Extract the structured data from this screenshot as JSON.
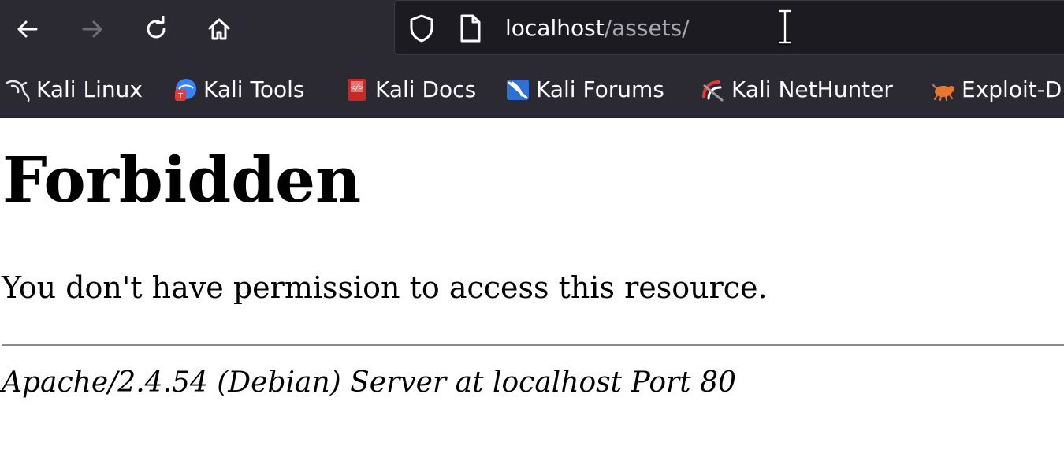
{
  "toolbar": {
    "back_icon": "arrow-left-icon",
    "forward_icon": "arrow-right-icon",
    "reload_icon": "reload-icon",
    "home_icon": "home-icon"
  },
  "urlbar": {
    "host": "localhost",
    "path": "/assets/",
    "shield_icon": "shield-icon",
    "page_icon": "page-icon"
  },
  "bookmarks": [
    {
      "label": "Kali Linux",
      "icon": "kali-dragon-icon"
    },
    {
      "label": "Kali Tools",
      "icon": "kali-tools-icon"
    },
    {
      "label": "Kali Docs",
      "icon": "kali-docs-icon"
    },
    {
      "label": "Kali Forums",
      "icon": "kali-forums-icon"
    },
    {
      "label": "Kali NetHunter",
      "icon": "kali-nethunter-icon"
    },
    {
      "label": "Exploit-DB",
      "icon": "exploit-db-icon"
    }
  ],
  "page": {
    "heading": "Forbidden",
    "message": "You don't have permission to access this resource.",
    "server_signature": "Apache/2.4.54 (Debian) Server at localhost Port 80"
  },
  "colors": {
    "toolbar_bg": "#2b2a33",
    "urlbar_bg": "#1c1b22",
    "text_light": "#fbfbfe",
    "path_gray": "#a8a8b3"
  }
}
